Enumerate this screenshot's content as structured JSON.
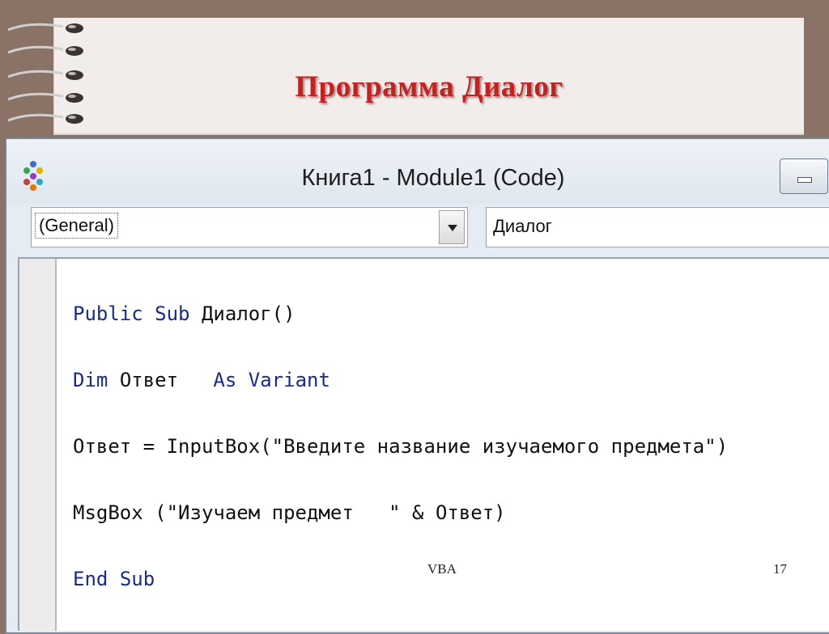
{
  "slide": {
    "title": "Программа Диалог",
    "footer_center": "VBA",
    "page_number": "17"
  },
  "window": {
    "title": "Книга1 - Module1 (Code)",
    "object_combo": "(General)",
    "procedure_combo": "Диалог"
  },
  "code": {
    "line1": {
      "kw1": "Public",
      "kw2": "Sub",
      "rest": "Диалог()"
    },
    "line2": {
      "kw1": "Dim",
      "name": "Ответ",
      "kw2": "As",
      "kw3": "Variant"
    },
    "line3": "Ответ = InputBox(\"Введите название изучаемого предмета\")",
    "line4": {
      "a": "MsgBox (\"Изучаем предмет   \"",
      "op": "&",
      "b": "Ответ)"
    },
    "line5": {
      "kw1": "End",
      "kw2": "Sub"
    }
  },
  "colors": {
    "title_red": "#c8201f",
    "keyword_blue": "#1a2b8c",
    "slide_frame": "#8b7266"
  },
  "icons": [
    "spiral-binding-icon",
    "vbe-app-icon",
    "minimize-icon",
    "dropdown-arrow-icon"
  ]
}
